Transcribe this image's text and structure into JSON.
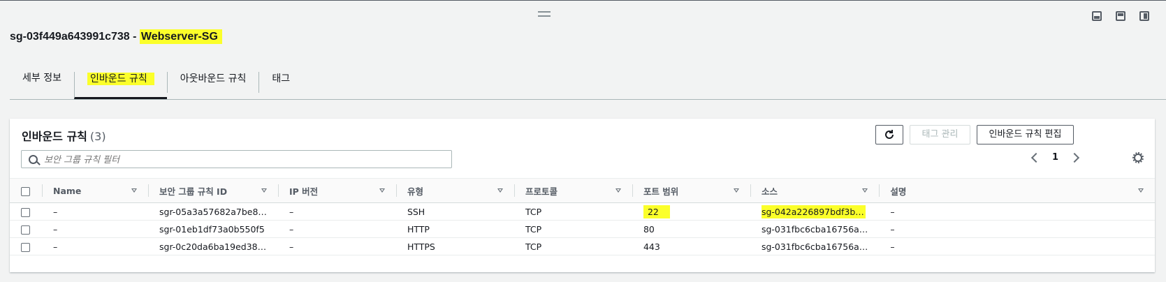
{
  "header": {
    "sg_id": "sg-03f449a643991c738 - ",
    "sg_name": "Webserver-SG"
  },
  "tabs": [
    {
      "label": "세부 정보"
    },
    {
      "label": "인바운드 규칙"
    },
    {
      "label": "아웃바운드 규칙"
    },
    {
      "label": "태그"
    }
  ],
  "panel": {
    "title": "인바운드 규칙",
    "count": "(3)",
    "refresh_icon": "refresh-icon",
    "manage_tags_label": "태그 관리",
    "edit_rules_label": "인바운드 규칙 편집",
    "search_placeholder": "보안 그룹 규칙 필터",
    "page": "1"
  },
  "table": {
    "columns": [
      "Name",
      "보안 그룹 규칙 ID",
      "IP 버전",
      "유형",
      "프로토콜",
      "포트 범위",
      "소스",
      "설명"
    ],
    "rows": [
      {
        "name": "–",
        "rule_id": "sgr-05a3a57682a7be8…",
        "ip": "–",
        "type": "SSH",
        "protocol": "TCP",
        "port": "22",
        "source": "sg-042a226897bdf3b…",
        "desc": "–"
      },
      {
        "name": "–",
        "rule_id": "sgr-01eb1df73a0b550f5",
        "ip": "–",
        "type": "HTTP",
        "protocol": "TCP",
        "port": "80",
        "source": "sg-031fbc6cba16756a…",
        "desc": "–"
      },
      {
        "name": "–",
        "rule_id": "sgr-0c20da6ba19ed38…",
        "ip": "–",
        "type": "HTTPS",
        "protocol": "TCP",
        "port": "443",
        "source": "sg-031fbc6cba16756a…",
        "desc": "–"
      }
    ]
  },
  "colors": {
    "highlight": "#fbff2a",
    "text": "#16191f"
  }
}
